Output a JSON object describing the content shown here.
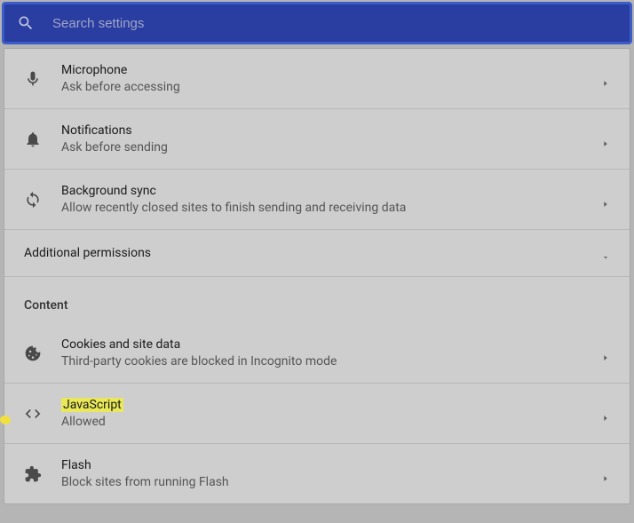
{
  "search": {
    "placeholder": "Search settings"
  },
  "rows": {
    "microphone": {
      "title": "Microphone",
      "subtitle": "Ask before accessing"
    },
    "notifications": {
      "title": "Notifications",
      "subtitle": "Ask before sending"
    },
    "backgroundSync": {
      "title": "Background sync",
      "subtitle": "Allow recently closed sites to finish sending and receiving data"
    },
    "cookies": {
      "title": "Cookies and site data",
      "subtitle": "Third-party cookies are blocked in Incognito mode"
    },
    "javascript": {
      "title": "JavaScript",
      "subtitle": "Allowed"
    },
    "flash": {
      "title": "Flash",
      "subtitle": "Block sites from running Flash"
    }
  },
  "sections": {
    "additionalPermissions": "Additional permissions",
    "content": "Content"
  }
}
